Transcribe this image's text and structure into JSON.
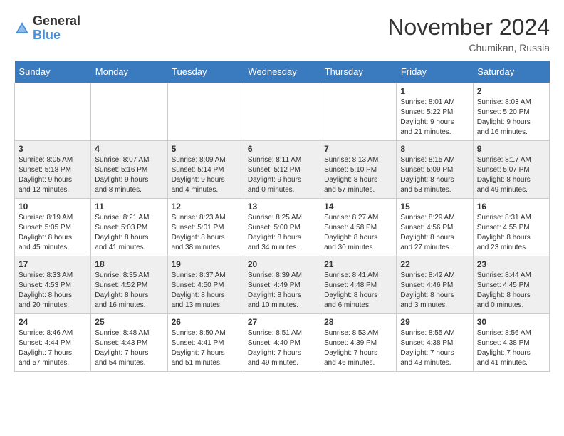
{
  "header": {
    "logo_general": "General",
    "logo_blue": "Blue",
    "month_title": "November 2024",
    "location": "Chumikan, Russia"
  },
  "weekdays": [
    "Sunday",
    "Monday",
    "Tuesday",
    "Wednesday",
    "Thursday",
    "Friday",
    "Saturday"
  ],
  "weeks": [
    [
      {
        "day": "",
        "info": ""
      },
      {
        "day": "",
        "info": ""
      },
      {
        "day": "",
        "info": ""
      },
      {
        "day": "",
        "info": ""
      },
      {
        "day": "",
        "info": ""
      },
      {
        "day": "1",
        "info": "Sunrise: 8:01 AM\nSunset: 5:22 PM\nDaylight: 9 hours\nand 21 minutes."
      },
      {
        "day": "2",
        "info": "Sunrise: 8:03 AM\nSunset: 5:20 PM\nDaylight: 9 hours\nand 16 minutes."
      }
    ],
    [
      {
        "day": "3",
        "info": "Sunrise: 8:05 AM\nSunset: 5:18 PM\nDaylight: 9 hours\nand 12 minutes."
      },
      {
        "day": "4",
        "info": "Sunrise: 8:07 AM\nSunset: 5:16 PM\nDaylight: 9 hours\nand 8 minutes."
      },
      {
        "day": "5",
        "info": "Sunrise: 8:09 AM\nSunset: 5:14 PM\nDaylight: 9 hours\nand 4 minutes."
      },
      {
        "day": "6",
        "info": "Sunrise: 8:11 AM\nSunset: 5:12 PM\nDaylight: 9 hours\nand 0 minutes."
      },
      {
        "day": "7",
        "info": "Sunrise: 8:13 AM\nSunset: 5:10 PM\nDaylight: 8 hours\nand 57 minutes."
      },
      {
        "day": "8",
        "info": "Sunrise: 8:15 AM\nSunset: 5:09 PM\nDaylight: 8 hours\nand 53 minutes."
      },
      {
        "day": "9",
        "info": "Sunrise: 8:17 AM\nSunset: 5:07 PM\nDaylight: 8 hours\nand 49 minutes."
      }
    ],
    [
      {
        "day": "10",
        "info": "Sunrise: 8:19 AM\nSunset: 5:05 PM\nDaylight: 8 hours\nand 45 minutes."
      },
      {
        "day": "11",
        "info": "Sunrise: 8:21 AM\nSunset: 5:03 PM\nDaylight: 8 hours\nand 41 minutes."
      },
      {
        "day": "12",
        "info": "Sunrise: 8:23 AM\nSunset: 5:01 PM\nDaylight: 8 hours\nand 38 minutes."
      },
      {
        "day": "13",
        "info": "Sunrise: 8:25 AM\nSunset: 5:00 PM\nDaylight: 8 hours\nand 34 minutes."
      },
      {
        "day": "14",
        "info": "Sunrise: 8:27 AM\nSunset: 4:58 PM\nDaylight: 8 hours\nand 30 minutes."
      },
      {
        "day": "15",
        "info": "Sunrise: 8:29 AM\nSunset: 4:56 PM\nDaylight: 8 hours\nand 27 minutes."
      },
      {
        "day": "16",
        "info": "Sunrise: 8:31 AM\nSunset: 4:55 PM\nDaylight: 8 hours\nand 23 minutes."
      }
    ],
    [
      {
        "day": "17",
        "info": "Sunrise: 8:33 AM\nSunset: 4:53 PM\nDaylight: 8 hours\nand 20 minutes."
      },
      {
        "day": "18",
        "info": "Sunrise: 8:35 AM\nSunset: 4:52 PM\nDaylight: 8 hours\nand 16 minutes."
      },
      {
        "day": "19",
        "info": "Sunrise: 8:37 AM\nSunset: 4:50 PM\nDaylight: 8 hours\nand 13 minutes."
      },
      {
        "day": "20",
        "info": "Sunrise: 8:39 AM\nSunset: 4:49 PM\nDaylight: 8 hours\nand 10 minutes."
      },
      {
        "day": "21",
        "info": "Sunrise: 8:41 AM\nSunset: 4:48 PM\nDaylight: 8 hours\nand 6 minutes."
      },
      {
        "day": "22",
        "info": "Sunrise: 8:42 AM\nSunset: 4:46 PM\nDaylight: 8 hours\nand 3 minutes."
      },
      {
        "day": "23",
        "info": "Sunrise: 8:44 AM\nSunset: 4:45 PM\nDaylight: 8 hours\nand 0 minutes."
      }
    ],
    [
      {
        "day": "24",
        "info": "Sunrise: 8:46 AM\nSunset: 4:44 PM\nDaylight: 7 hours\nand 57 minutes."
      },
      {
        "day": "25",
        "info": "Sunrise: 8:48 AM\nSunset: 4:43 PM\nDaylight: 7 hours\nand 54 minutes."
      },
      {
        "day": "26",
        "info": "Sunrise: 8:50 AM\nSunset: 4:41 PM\nDaylight: 7 hours\nand 51 minutes."
      },
      {
        "day": "27",
        "info": "Sunrise: 8:51 AM\nSunset: 4:40 PM\nDaylight: 7 hours\nand 49 minutes."
      },
      {
        "day": "28",
        "info": "Sunrise: 8:53 AM\nSunset: 4:39 PM\nDaylight: 7 hours\nand 46 minutes."
      },
      {
        "day": "29",
        "info": "Sunrise: 8:55 AM\nSunset: 4:38 PM\nDaylight: 7 hours\nand 43 minutes."
      },
      {
        "day": "30",
        "info": "Sunrise: 8:56 AM\nSunset: 4:38 PM\nDaylight: 7 hours\nand 41 minutes."
      }
    ]
  ]
}
